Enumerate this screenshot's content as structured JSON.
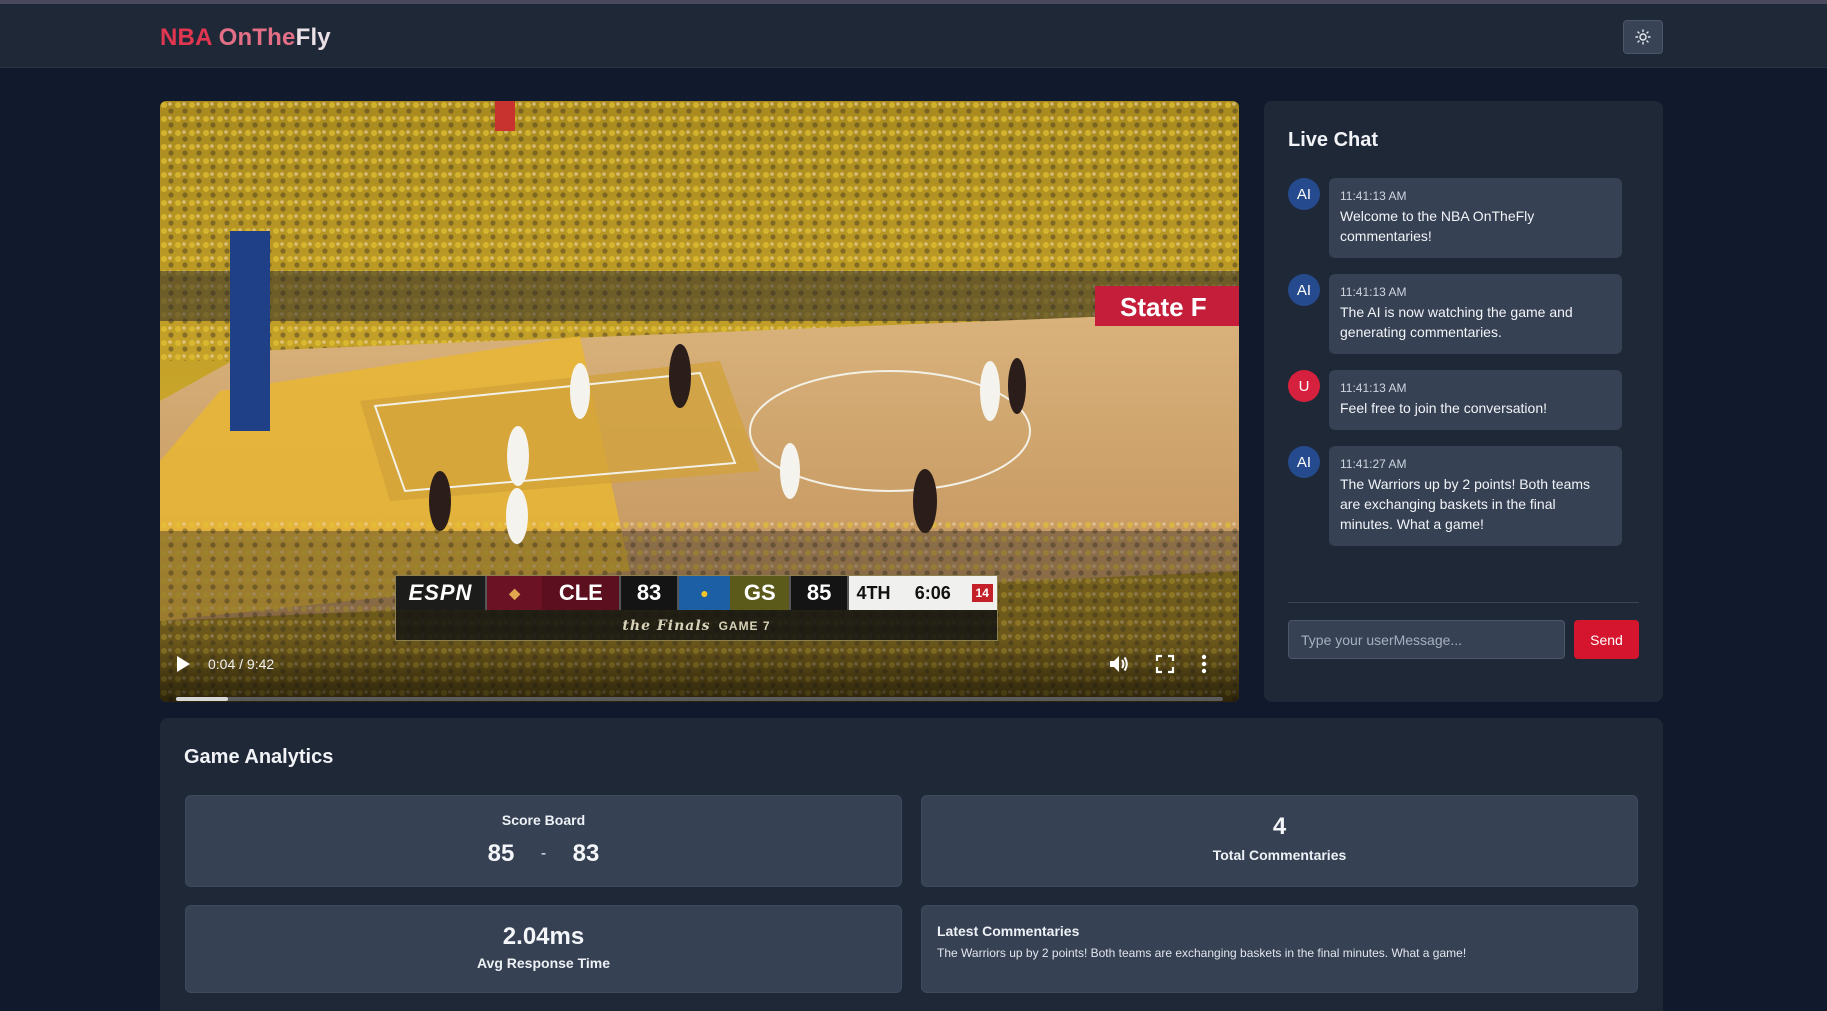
{
  "header": {
    "brand_part1": "NBA ",
    "brand_part2": "OnThe",
    "brand_part3": "Fly",
    "theme_toggle_icon": "sun-icon"
  },
  "video": {
    "scorebug": {
      "network": "ESPN",
      "away_team": "CLE",
      "away_score": "83",
      "home_team": "GS",
      "home_score": "85",
      "quarter": "4TH",
      "clock": "6:06",
      "shot_clock": "14",
      "event": "the Finals",
      "game": "GAME 7"
    },
    "time_display": "0:04 / 9:42",
    "progress_fraction": 0.007,
    "controls": [
      "play-icon",
      "volume-icon",
      "fullscreen-icon",
      "more-vert-icon"
    ]
  },
  "chat": {
    "title": "Live Chat",
    "messages": [
      {
        "sender": "AI",
        "time": "11:41:13 AM",
        "text": "Welcome to the NBA OnTheFly commentaries!"
      },
      {
        "sender": "AI",
        "time": "11:41:13 AM",
        "text": "The AI is now watching the game and generating commentaries."
      },
      {
        "sender": "U",
        "time": "11:41:13 AM",
        "text": "Feel free to join the conversation!"
      },
      {
        "sender": "AI",
        "time": "11:41:27 AM",
        "text": "The Warriors up by 2 points! Both teams are exchanging baskets in the final minutes. What a game!"
      }
    ],
    "input_placeholder": "Type your userMessage...",
    "input_value": "",
    "send_label": "Send"
  },
  "analytics": {
    "title": "Game Analytics",
    "scoreboard_label": "Score Board",
    "score_home": "85",
    "score_separator": "-",
    "score_away": "83",
    "total_commentaries_value": "4",
    "total_commentaries_label": "Total Commentaries",
    "avg_response_value": "2.04ms",
    "avg_response_label": "Avg Response Time",
    "latest_label": "Latest Commentaries",
    "latest_text": "The Warriors up by 2 points! Both teams are exchanging baskets in the final minutes. What a game!"
  },
  "colors": {
    "accent": "#d5152e",
    "panel": "#1f2837",
    "card": "#364153",
    "background": "#111a2c"
  }
}
